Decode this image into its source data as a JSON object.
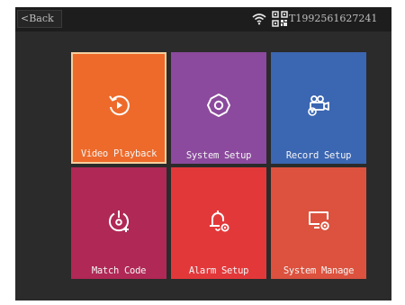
{
  "header": {
    "back_label": "<Back",
    "device_id": "T1992561627241",
    "status_icons": [
      "wifi-icon",
      "qr-code-icon"
    ]
  },
  "tiles": [
    {
      "label": "Video Playback",
      "icon": "playback-icon",
      "color": "#ee6a2a",
      "selected": true
    },
    {
      "label": "System Setup",
      "icon": "gear-icon",
      "color": "#8b4a9d"
    },
    {
      "label": "Record Setup",
      "icon": "camera-icon",
      "color": "#3b66b2"
    },
    {
      "label": "Match Code",
      "icon": "match-code-icon",
      "color": "#b02855"
    },
    {
      "label": "Alarm Setup",
      "icon": "alarm-bell-icon",
      "color": "#e3383a"
    },
    {
      "label": "System Manage",
      "icon": "monitor-settings-icon",
      "color": "#dc523e"
    }
  ]
}
